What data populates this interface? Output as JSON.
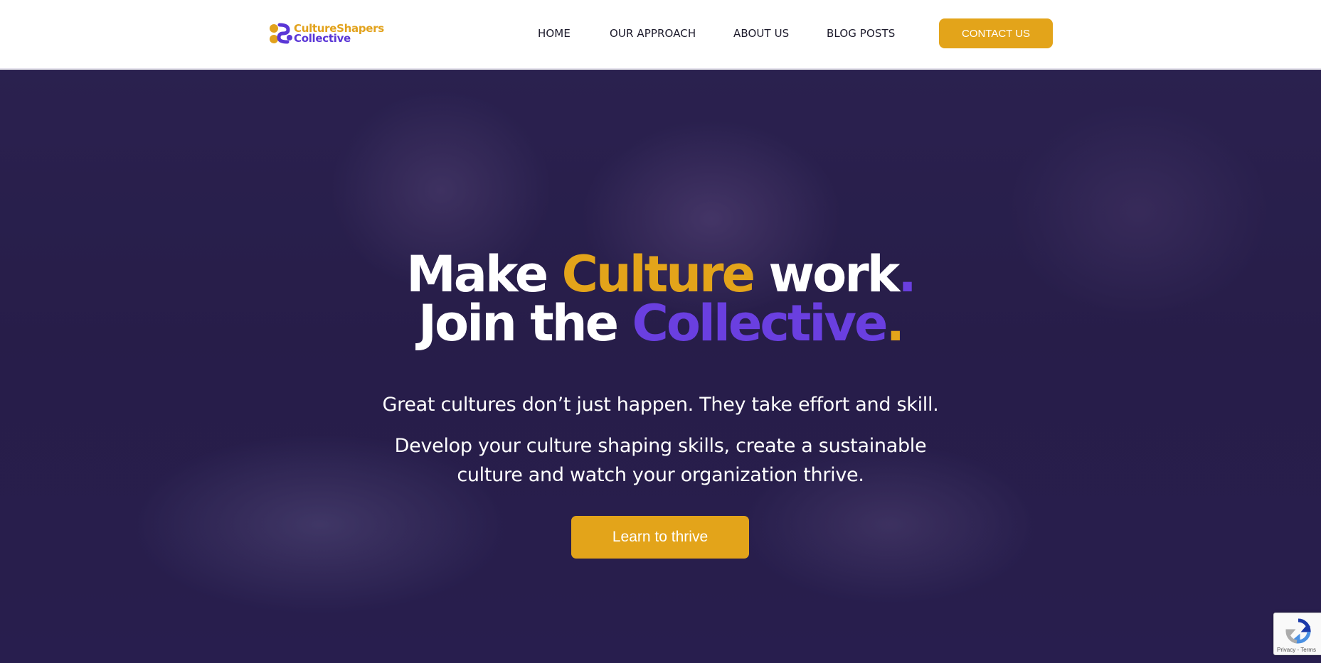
{
  "logo": {
    "line1": "CultureShapers",
    "line2": "Collective"
  },
  "nav": {
    "items": [
      {
        "label": "HOME"
      },
      {
        "label": "OUR APPROACH"
      },
      {
        "label": "ABOUT US"
      },
      {
        "label": "BLOG POSTS"
      }
    ],
    "cta_label": "CONTACT US"
  },
  "hero": {
    "headline_line1": {
      "part1": "Make ",
      "highlight": "Culture",
      "part2": " work",
      "dot": "."
    },
    "headline_line2": {
      "part1": "Join the ",
      "highlight": "Collective",
      "dot": "."
    },
    "subtitle1": "Great cultures don’t just happen. They take effort and skill.",
    "subtitle2_line1": "Develop your culture shaping skills, create a sustainable",
    "subtitle2_line2": "culture and watch your organization thrive.",
    "cta_label": "Learn to thrive"
  },
  "recaptcha": {
    "footer": "Privacy - Terms"
  },
  "colors": {
    "accent_yellow": "#e3a41a",
    "accent_purple": "#6a3fe0",
    "hero_overlay": "#2b2150"
  }
}
